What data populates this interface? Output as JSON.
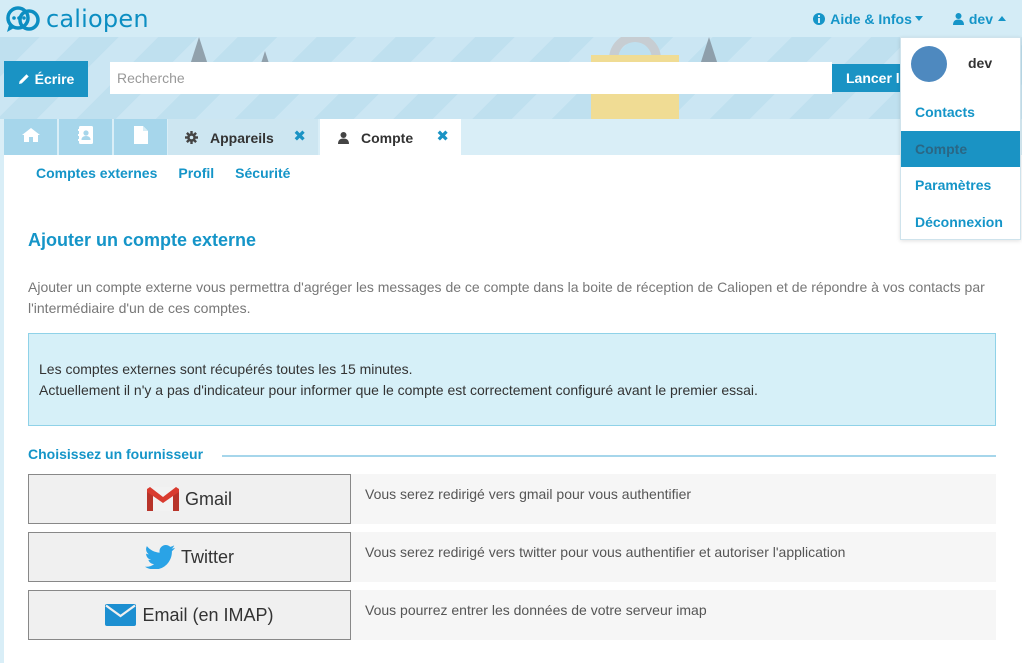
{
  "app": {
    "logo_text": "caliopen"
  },
  "nav": {
    "help_label": "Aide & Infos",
    "user_label": "dev"
  },
  "toolbar": {
    "write_label": "Écrire",
    "search_placeholder": "Recherche",
    "search_button_label": "Lancer la recherche"
  },
  "tabs": [
    {
      "label": "Appareils"
    },
    {
      "label": "Compte"
    }
  ],
  "subnav": [
    {
      "label": "Comptes externes"
    },
    {
      "label": "Profil"
    },
    {
      "label": "Sécurité"
    }
  ],
  "main": {
    "title": "Ajouter un compte externe",
    "intro": "Ajouter un compte externe vous permettra d'agréger les messages de ce compte dans la boite de réception de Caliopen et de répondre à vos contacts par l'intermédiaire d'un de ces comptes.",
    "notice_line1": "Les comptes externes sont récupérés toutes les 15 minutes.",
    "notice_line2": "Actuellement il n'y a pas d'indicateur pour informer que le compte est correctement configuré avant le premier essai.",
    "provider_legend": "Choisissez un fournisseur",
    "providers": [
      {
        "label": "Gmail",
        "description": "Vous serez redirigé vers gmail pour vous authentifier",
        "icon": "gmail-icon"
      },
      {
        "label": "Twitter",
        "description": "Vous serez redirigé vers twitter pour vous authentifier et autoriser l'application",
        "icon": "twitter-icon"
      },
      {
        "label": "Email (en IMAP)",
        "description": "Vous pourrez entrer les données de votre serveur imap",
        "icon": "envelope-icon"
      }
    ]
  },
  "user_menu": {
    "name": "dev",
    "items": [
      {
        "label": "Contacts"
      },
      {
        "label": "Compte",
        "active": true
      },
      {
        "label": "Paramètres"
      },
      {
        "label": "Déconnexion"
      }
    ]
  },
  "colors": {
    "accent": "#1a93c4",
    "link": "#1595c8",
    "notice_bg": "#d6f0f8",
    "avatar": "#4e89bf"
  }
}
